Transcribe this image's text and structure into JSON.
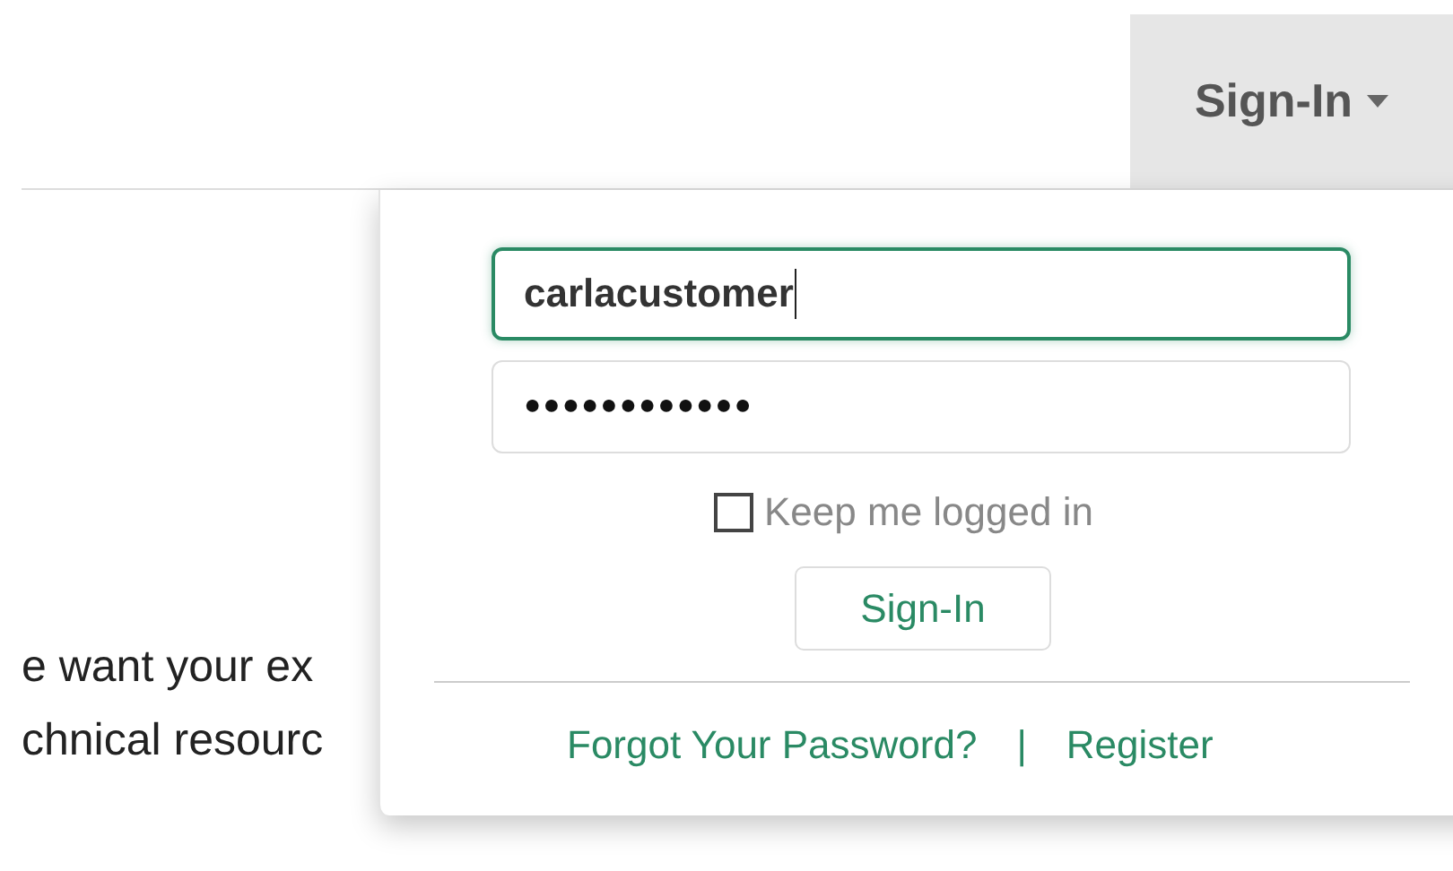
{
  "header": {
    "signin_menu": {
      "label": "Sign-In",
      "expanded": true
    }
  },
  "body_text": [
    "e want your ex",
    "chnical resourc"
  ],
  "login_dropdown": {
    "fields": [
      {
        "kind": "text",
        "value": "carlacustomer",
        "focused": true
      },
      {
        "kind": "password",
        "value": "●●●●●●●●●●●●",
        "focused": false
      }
    ],
    "keep_logged_in": {
      "label": "Keep me logged in",
      "checked": false
    },
    "submit": "Sign-In",
    "links": [
      "Forgot Your Password?",
      "Register"
    ],
    "link_separator": "|"
  }
}
